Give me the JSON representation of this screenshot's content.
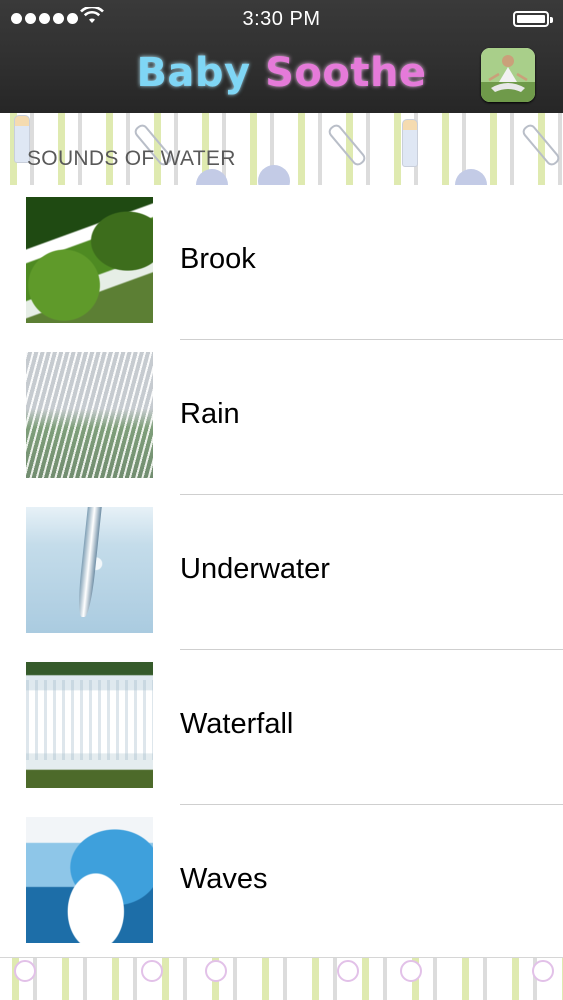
{
  "status_bar": {
    "time": "3:30 PM",
    "signal_bars": 5,
    "wifi": "wifi-icon",
    "battery_level": 1.0
  },
  "nav": {
    "title_part1": "Baby",
    "title_part2": "Soothe",
    "right_button_icon": "meditation-avatar-icon"
  },
  "section": {
    "title": "SOUNDS OF WATER"
  },
  "items": [
    {
      "label": "Brook",
      "thumb": "brook"
    },
    {
      "label": "Rain",
      "thumb": "rain"
    },
    {
      "label": "Underwater",
      "thumb": "underwater"
    },
    {
      "label": "Waterfall",
      "thumb": "waterfall"
    },
    {
      "label": "Waves",
      "thumb": "waves"
    }
  ],
  "colors": {
    "title_blue": "#7fd6f5",
    "title_pink": "#e57ad9",
    "bar_bg": "#2f2f2f"
  }
}
